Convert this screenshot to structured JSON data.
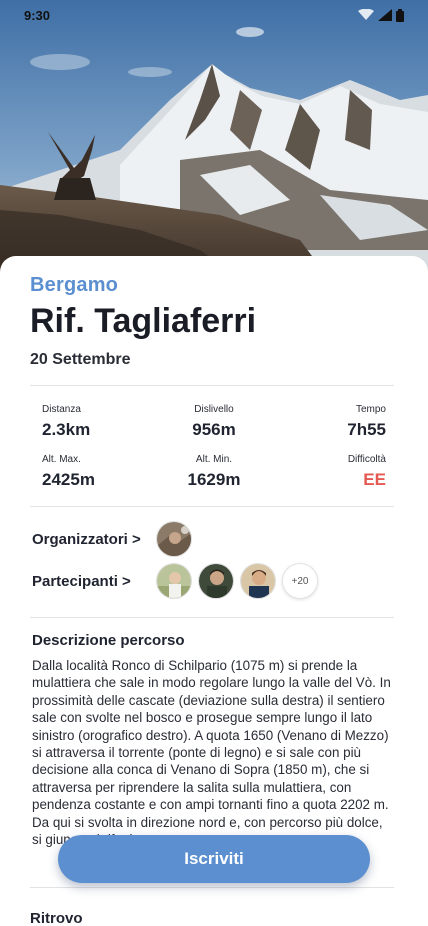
{
  "status_bar": {
    "time": "9:30"
  },
  "trip": {
    "city": "Bergamo",
    "title": "Rif. Tagliaferri",
    "date": "20 Settembre"
  },
  "stats": {
    "distance": {
      "label": "Distanza",
      "value": "2.3km"
    },
    "elevation": {
      "label": "Dislivello",
      "value": "956m"
    },
    "time": {
      "label": "Tempo",
      "value": "7h55"
    },
    "alt_max": {
      "label": "Alt. Max.",
      "value": "2425m"
    },
    "alt_min": {
      "label": "Alt. Min.",
      "value": "1629m"
    },
    "difficulty": {
      "label": "Difficoltà",
      "value": "EE"
    }
  },
  "people": {
    "organizers_label": "Organizzatori >",
    "participants_label": "Partecipanti >",
    "more_count": "+20"
  },
  "description": {
    "title": "Descrizione percorso",
    "text": "Dalla località Ronco di Schilpario (1075 m) si prende la mulattiera che sale in modo regolare lungo la valle del Vò. In prossimità delle cascate (deviazione sulla destra) il sentiero sale con svolte nel bosco e prosegue sempre lungo il lato sinistro (orografico destro). A quota 1650 (Venano di Mezzo) si attraversa il torrente (ponte di legno) e si sale con più decisione alla conca di Venano di Sopra (1850 m), che si attraversa per riprendere la salita sulla mulattiera, con pendenza costante e con ampi tornanti fino a quota 2202 m. Da qui si svolta in direzione nord e, con percorso più dolce, si giunge al rifugio."
  },
  "meeting": {
    "title": "Ritrovo"
  },
  "cta": {
    "label": "Iscriviti"
  },
  "colors": {
    "accent": "#5b8fd0",
    "danger": "#e45a52"
  }
}
